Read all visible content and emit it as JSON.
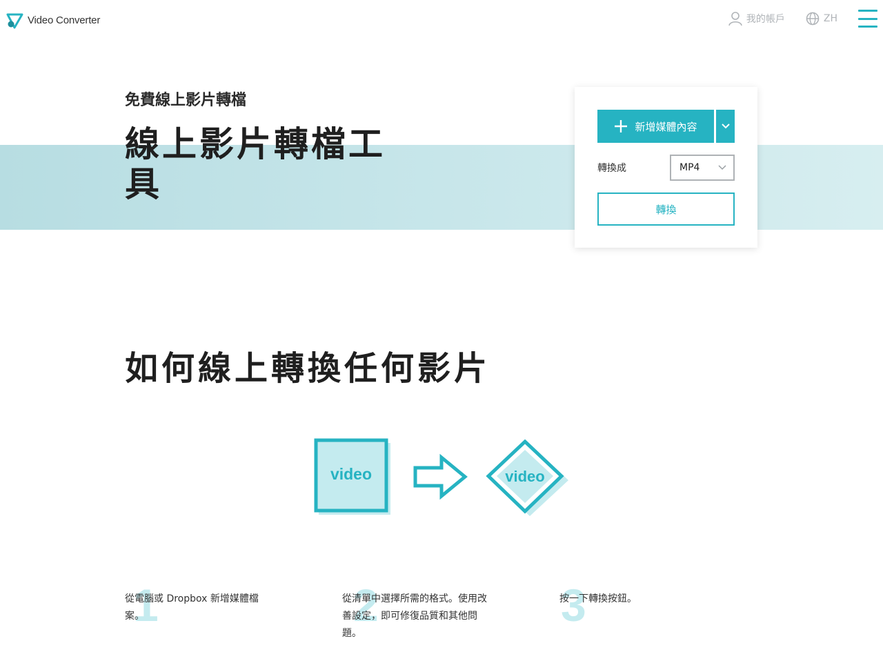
{
  "header": {
    "logo_text": "Video Converter",
    "account_label": "我的帳戶",
    "language_label": "ZH"
  },
  "hero": {
    "subtitle": "免費線上影片轉檔",
    "title": "線上影片轉檔工具"
  },
  "converter": {
    "add_media_label": "新增媒體內容",
    "convert_to_label": "轉換成",
    "format_value": "MP4",
    "convert_button_label": "轉換"
  },
  "how_to": {
    "title": "如何線上轉換任何影片",
    "illustration": {
      "source_label": "video",
      "target_label": "video"
    },
    "steps": [
      {
        "number": "1",
        "text": "從電腦或 Dropbox 新增媒體檔案。"
      },
      {
        "number": "2",
        "text": "從清單中選擇所需的格式。使用改善設定，即可修復品質和其他問題。"
      },
      {
        "number": "3",
        "text": "按一下轉換按鈕。"
      }
    ]
  },
  "colors": {
    "accent": "#26b3c2",
    "accent_light": "#c4ebef",
    "band": "#c2e3e8",
    "nav_gray": "#b0b4b8"
  }
}
